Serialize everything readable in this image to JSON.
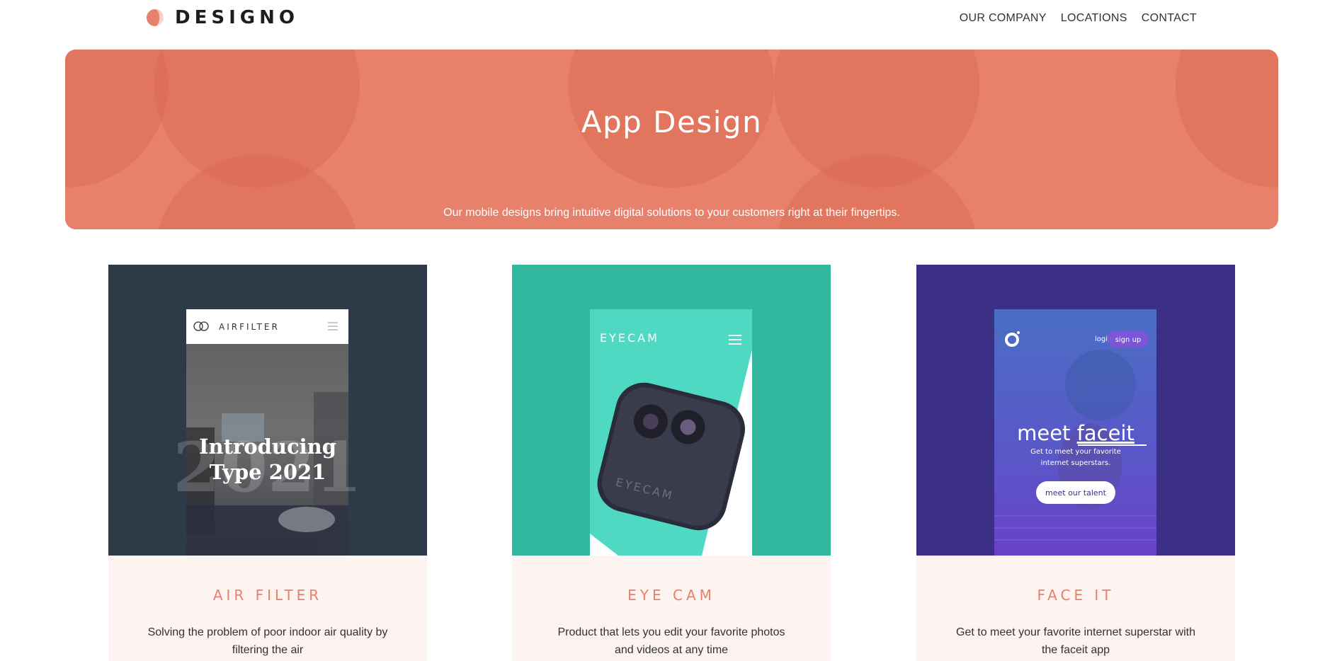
{
  "brand": {
    "name": "DESIGNO",
    "accent": "#e7816b"
  },
  "nav": {
    "items": [
      "OUR COMPANY",
      "LOCATIONS",
      "CONTACT"
    ]
  },
  "hero": {
    "title": "App Design",
    "subtitle": "Our mobile designs bring intuitive digital solutions to your customers right at their fingertips."
  },
  "cards": [
    {
      "title": "AIR FILTER",
      "description": "Solving the problem of poor indoor air quality by filtering the air",
      "bg": "#2f3a48",
      "mock": {
        "brand": "AIRFILTER",
        "headline_1": "Introducing",
        "headline_2": "Type 2021",
        "watermark": "2021"
      }
    },
    {
      "title": "EYE CAM",
      "description": "Product that lets you edit your favorite photos and videos at any time",
      "bg": "#33b8a0",
      "mock": {
        "brand": "EYECAM",
        "device_label": "EYECAM"
      }
    },
    {
      "title": "FACE IT",
      "description": "Get to meet your favorite internet superstar with the faceit app",
      "bg": "#3c2f86",
      "mock": {
        "login": "login",
        "signup": "sign up",
        "headline_1": "meet",
        "headline_2": "faceit",
        "sub_1": "Get to meet your favorite",
        "sub_2": "internet superstars.",
        "cta": "meet our talent"
      }
    }
  ]
}
